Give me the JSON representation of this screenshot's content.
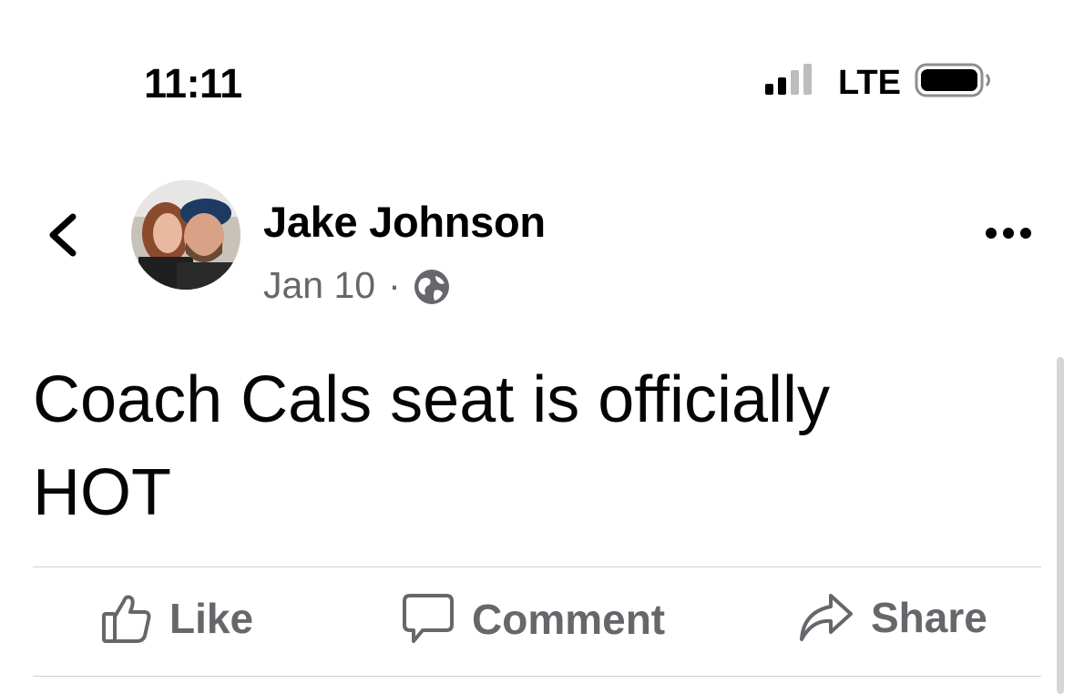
{
  "status_bar": {
    "time": "11:11",
    "network": "LTE",
    "signal_icon": "signal-bars-icon",
    "battery_icon": "battery-icon"
  },
  "post": {
    "author": "Jake Johnson",
    "date": "Jan 10",
    "separator": "·",
    "privacy_icon": "globe-icon",
    "text": "Coach Cals seat is officially HOT"
  },
  "actions": {
    "like": "Like",
    "comment": "Comment",
    "share": "Share"
  },
  "colors": {
    "secondary_text": "#65676b",
    "divider": "#d0d2d6",
    "text": "#050505"
  }
}
